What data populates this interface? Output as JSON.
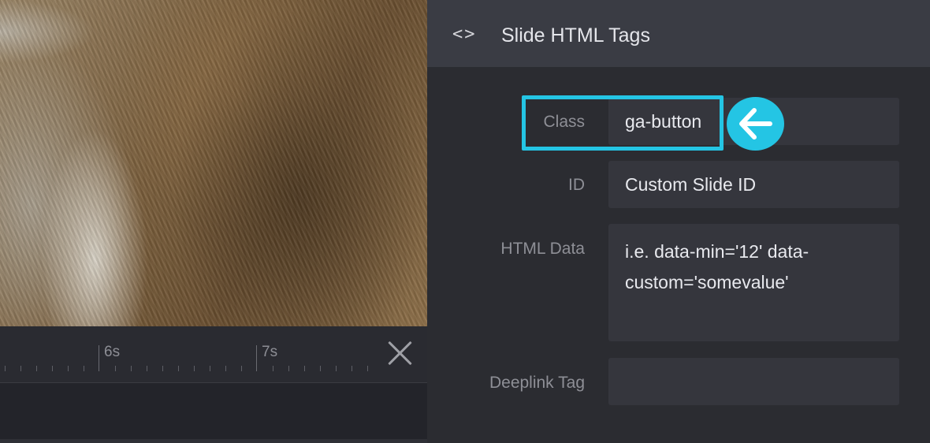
{
  "timeline": {
    "ticks": [
      {
        "label": "6s"
      },
      {
        "label": "7s"
      }
    ]
  },
  "panel": {
    "title": "Slide HTML Tags",
    "header_icon": "code-icon",
    "fields": {
      "class": {
        "label": "Class",
        "value": "ga-button"
      },
      "id": {
        "label": "ID",
        "placeholder": "Custom Slide ID"
      },
      "html_data": {
        "label": "HTML Data",
        "placeholder": "i.e. data-min='12' data-custom='somevalue'"
      },
      "deeplink": {
        "label": "Deeplink Tag",
        "value": ""
      }
    }
  },
  "annotations": {
    "highlight_color": "#24c5e4",
    "arrow_icon": "arrow-left-icon"
  },
  "colors": {
    "panel_bg": "#2b2c31",
    "header_bg": "#3a3c44",
    "input_bg": "#35363d",
    "accent": "#24c5e4"
  }
}
